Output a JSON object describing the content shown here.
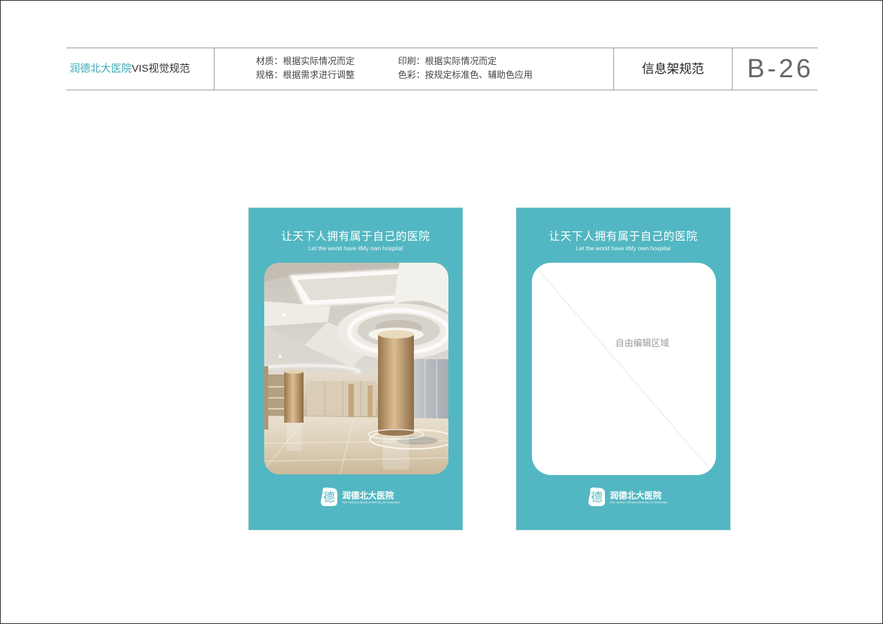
{
  "header": {
    "brand_name": "润德北大医院",
    "brand_suffix": "VIS视觉规范",
    "specs": {
      "material": "材质：根据实际情况而定",
      "size": "规格：根据需求进行调整",
      "printing": "印刷：根据实际情况而定",
      "color": "色彩：按规定标准色、辅助色应用"
    },
    "section_title": "信息架规范",
    "page_code": "B-26"
  },
  "colors": {
    "brand_teal": "#52b7c2",
    "brand_text_teal": "#3aa9b6"
  },
  "panels": [
    {
      "slogan_cn": "让天下人拥有属于自己的医院",
      "slogan_en": "Let the world have itMy own hospital"
    },
    {
      "slogan_cn": "让天下人拥有属于自己的医院",
      "slogan_en": "Let the world have itMy own hospital",
      "placeholder": "自由编辑区域"
    }
  ],
  "logo": {
    "mark": "德",
    "name": "润德北大医院",
    "tagline": "RDE WORLD BEIDA HOSPITAL OF KUNMING"
  }
}
